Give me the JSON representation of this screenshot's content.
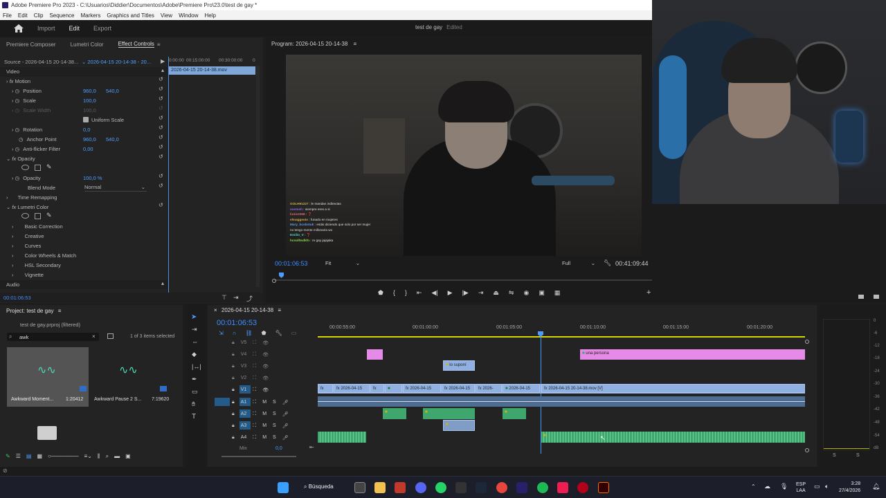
{
  "window": {
    "title": "Adobe Premiere Pro 2023 - C:\\Usuarios\\Diddier\\Documentos\\Adobe\\Premiere Pro\\23.0\\test de gay *"
  },
  "menu": [
    "File",
    "Edit",
    "Clip",
    "Sequence",
    "Markers",
    "Graphics and Titles",
    "View",
    "Window",
    "Help"
  ],
  "nav": {
    "import": "Import",
    "edit": "Edit",
    "export": "Export",
    "sequence_title": "test de gay",
    "edited": "Edited"
  },
  "left_tabs": [
    "Premiere Composer",
    "Lumetri Color",
    "Effect Controls"
  ],
  "effect_controls": {
    "source": "Source - 2026-04-15 20-14-38...",
    "clip": "2026-04-15 20-14-38 - 20...",
    "ruler": [
      "0:00:00",
      "00:15:00:00",
      "00:30:00:00"
    ],
    "ruler_end": "0",
    "clip_name": "2026-04-15 20-14-38.mov",
    "video_label": "Video",
    "motion": "Motion",
    "position": {
      "label": "Position",
      "x": "960,0",
      "y": "540,0"
    },
    "scale": {
      "label": "Scale",
      "value": "100,0"
    },
    "scale_width": {
      "label": "Scale Width",
      "value": "100,0"
    },
    "uniform_scale": "Uniform Scale",
    "rotation": {
      "label": "Rotation",
      "value": "0,0"
    },
    "anchor": {
      "label": "Anchor Point",
      "x": "960,0",
      "y": "540,0"
    },
    "anti_flicker": {
      "label": "Anti-flicker Filter",
      "value": "0,00"
    },
    "opacity_group": "Opacity",
    "opacity": {
      "label": "Opacity",
      "value": "100,0 %"
    },
    "blend": {
      "label": "Blend Mode",
      "value": "Normal"
    },
    "time_remap": "Time Remapping",
    "lumetri": "Lumetri Color",
    "lumetri_items": [
      "Basic Correction",
      "Creative",
      "Curves",
      "Color Wheels & Match",
      "HSL Secondary",
      "Vignette"
    ],
    "audio_label": "Audio",
    "timecode": "00:01:06:53"
  },
  "program": {
    "title": "Program: 2026-04-15 20-14-38",
    "timecode": "00:01:06:53",
    "fit": "Fit",
    "full": "Full",
    "duration": "00:41:09:44"
  },
  "chat": [
    {
      "user": "GOLH91227",
      "msg": "le mandan indirectas"
    },
    {
      "user": "soctosh",
      "msg": "siempre eres a si"
    },
    {
      "user": "lizzie2368",
      "msg": "❓"
    },
    {
      "user": "elmaggeato",
      "msg": "funado en mujeres"
    },
    {
      "user": "Mary_bcsbntuk",
      "msg": "estás diciendo que solo por ser mujer no tengo mente millonaria wo"
    },
    {
      "user": "Emilio_V",
      "msg": "❓"
    },
    {
      "user": "hcnolltodkfn",
      "msg": "re gay jajajaka"
    }
  ],
  "project": {
    "title": "Project: test de gay",
    "filter": "test de gay.prproj (filtered)",
    "search": "awk",
    "count": "1 of 3 items selected",
    "items": [
      {
        "name": "Awkward Moment...",
        "duration": "1:20412"
      },
      {
        "name": "Awkward Pause 2 S...",
        "duration": "7:19620"
      }
    ]
  },
  "timeline": {
    "tab": "2026-04-15 20-14-38",
    "timecode": "00:01:06:53",
    "ruler": [
      "00:00:55:00",
      "00:01:00:00",
      "00:01:05:00",
      "00:01:10:00",
      "00:01:15:00",
      "00:01:20:00"
    ],
    "tracks_v": [
      "V5",
      "V4",
      "V3",
      "V2",
      "V1"
    ],
    "tracks_a": [
      "A1",
      "A2",
      "A3",
      "A4"
    ],
    "mix": "Mix",
    "mix_value": "0,0",
    "clip_text_a": "una persona",
    "clip_text_b": "lo suponí",
    "v1_labels": [
      "2026-04-15",
      "2026-04-15",
      "2026-04-15",
      "2026-",
      "2026-04-15",
      "2026-04-15 20-14-38.mov [V]"
    ]
  },
  "meters": {
    "scale": [
      "0",
      "-6",
      "-12",
      "-18",
      "-24",
      "-30",
      "-36",
      "-42",
      "-48",
      "-54",
      "dB"
    ],
    "s1": "S",
    "s2": "S"
  },
  "taskbar": {
    "search": "Búsqueda",
    "lang1": "ESP",
    "lang2": "LAA",
    "time": "3:28",
    "date": "27/4/2026"
  }
}
